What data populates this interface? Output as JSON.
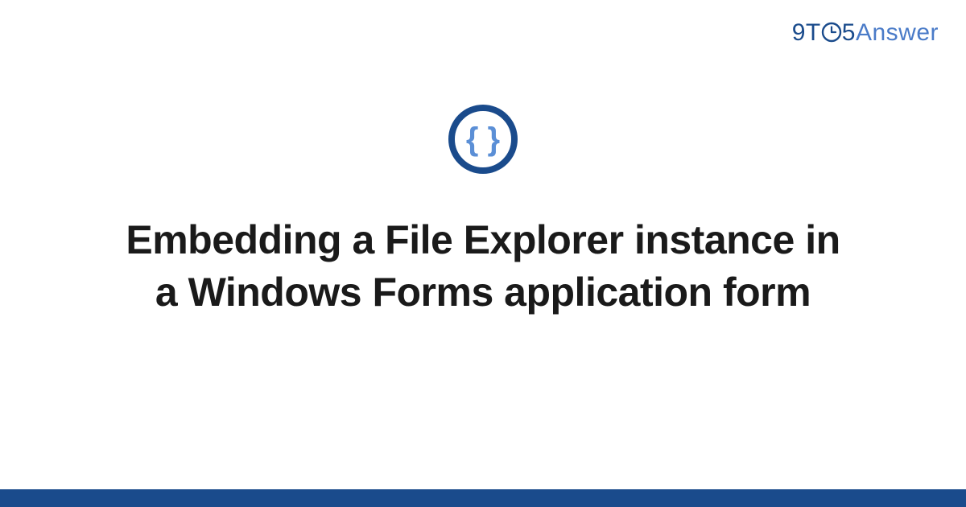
{
  "brand": {
    "part1": "9T",
    "part2": "5",
    "part3": "Answer"
  },
  "icon": {
    "name": "code-braces-icon"
  },
  "title": "Embedding a File Explorer instance in a Windows Forms application form",
  "colors": {
    "brand_dark": "#1a4b8c",
    "brand_light": "#4a7bc8",
    "icon_ring": "#1a4b8c",
    "icon_braces": "#5b8fd6",
    "footer": "#1a4b8c"
  }
}
